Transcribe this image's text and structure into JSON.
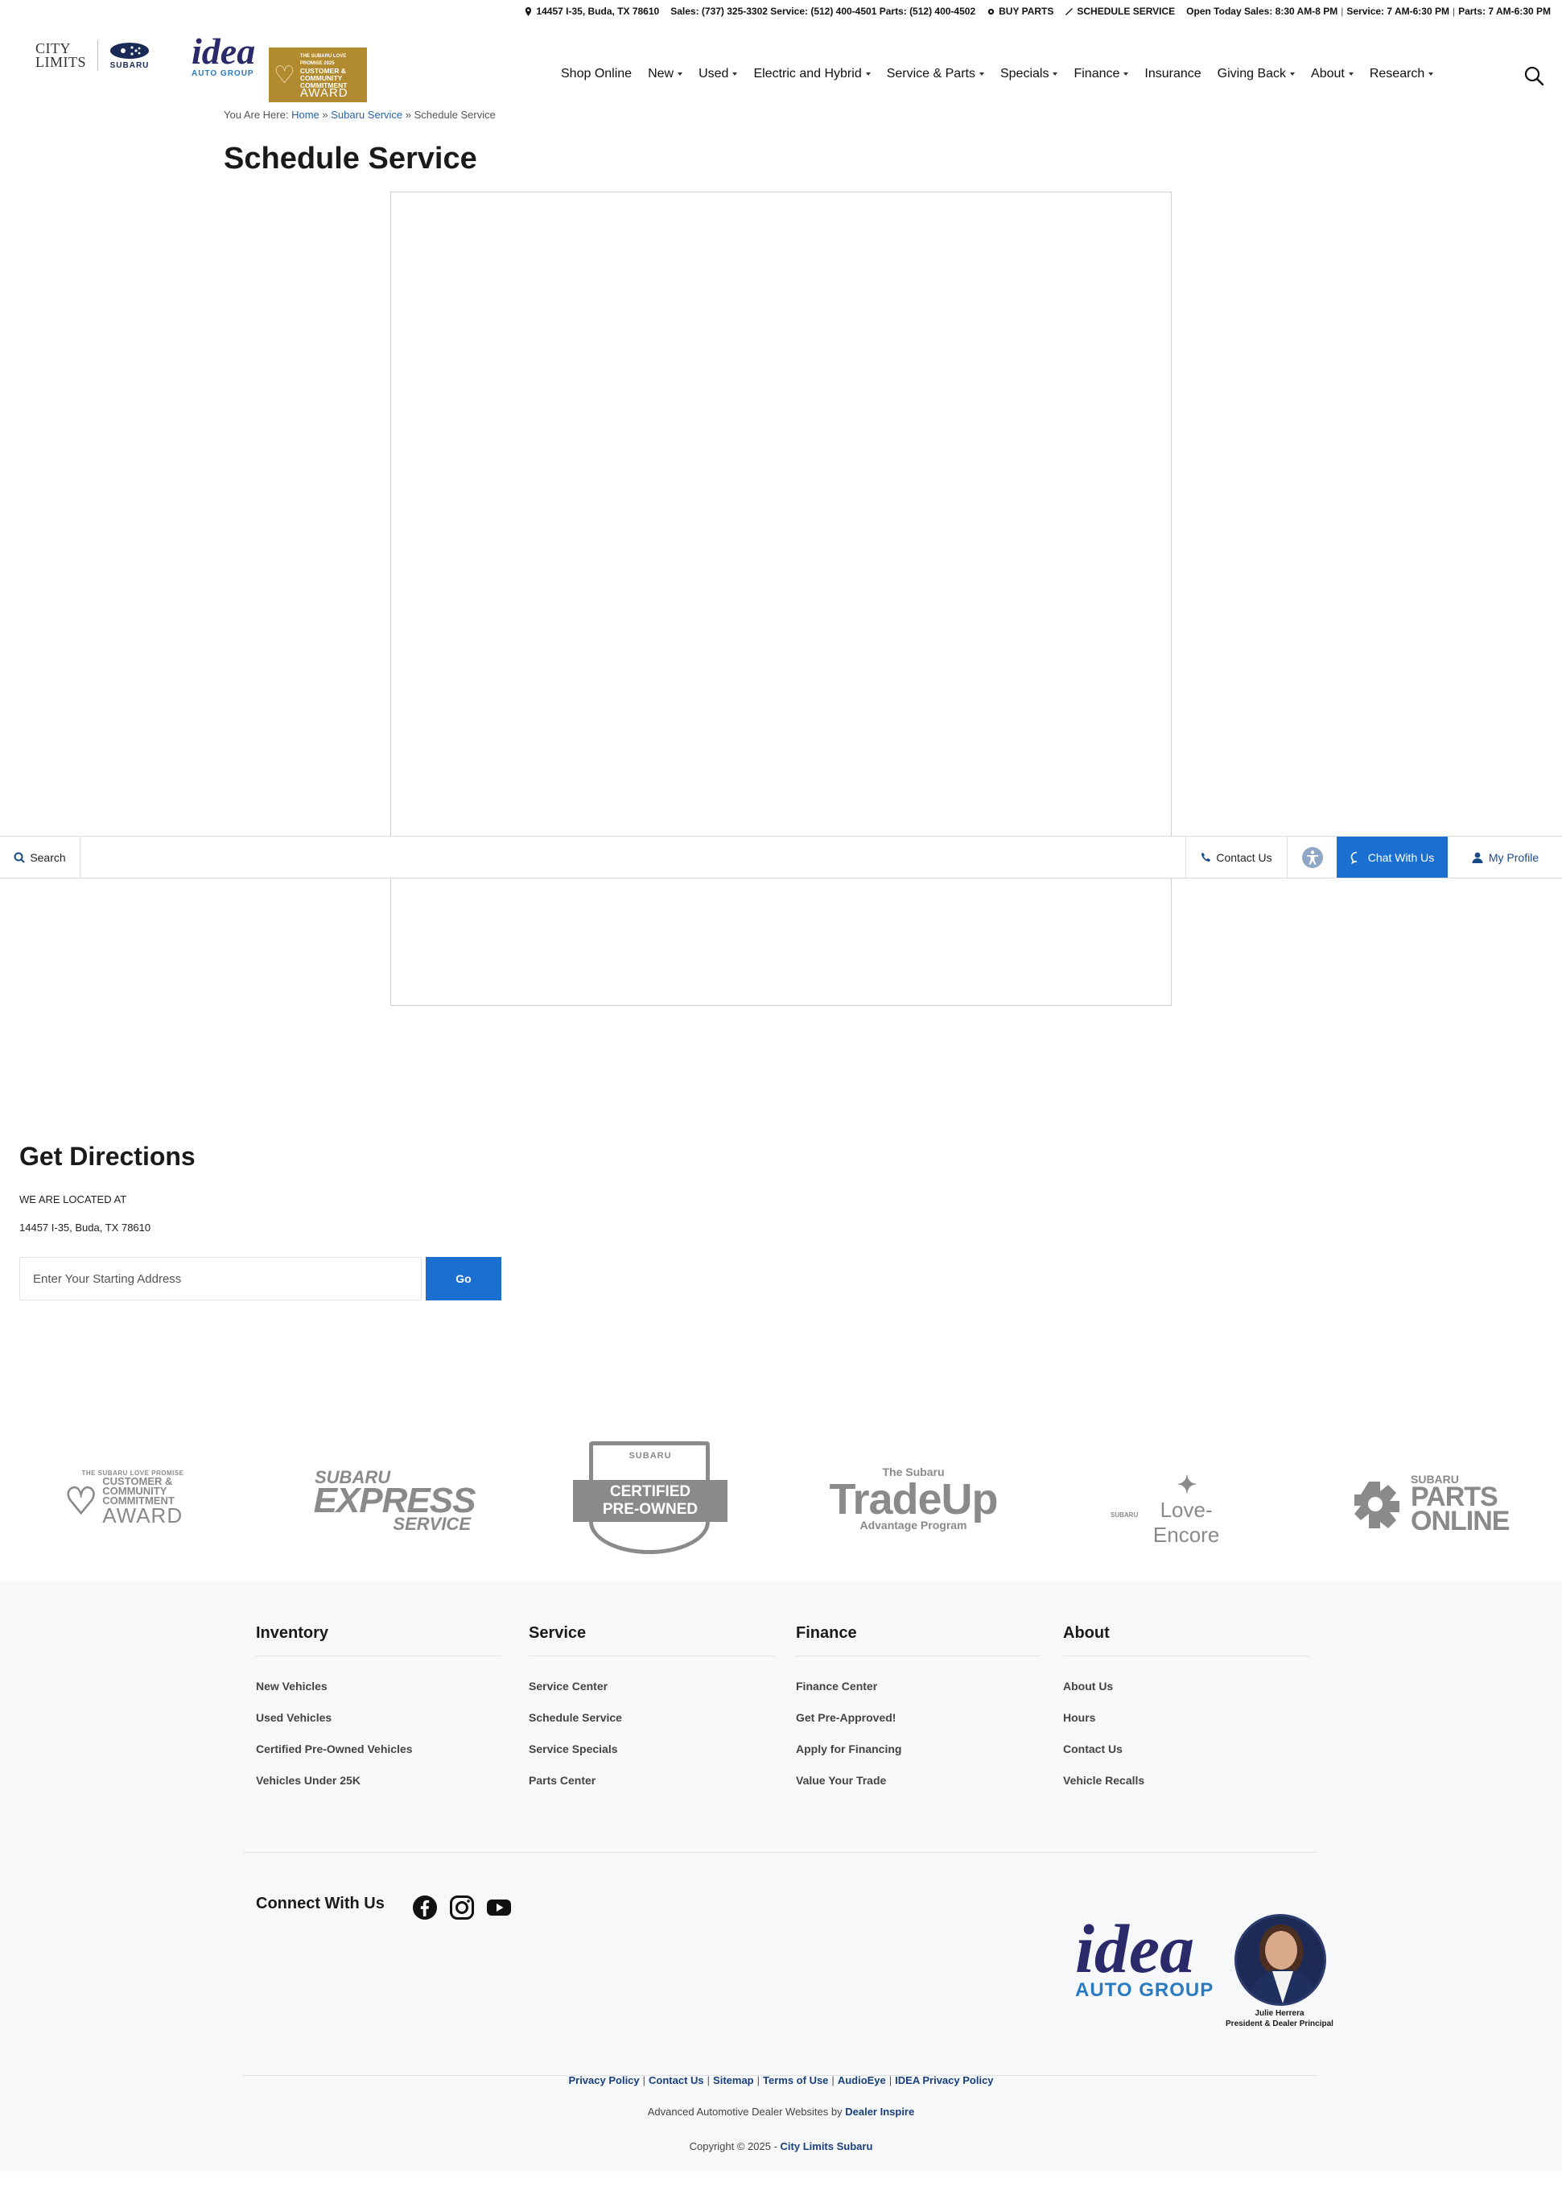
{
  "topbar": {
    "address": "14457 I-35, Buda, TX 78610",
    "phones": "Sales: (737) 325-3302  Service: (512) 400-4501  Parts: (512) 400-4502",
    "buy_parts": "BUY PARTS",
    "schedule_service": "SCHEDULE SERVICE",
    "hours_sales": "Open Today Sales: 8:30 AM-8 PM",
    "hours_service": "Service: 7 AM-6:30 PM",
    "hours_parts": "Parts: 7 AM-6:30 PM",
    "separator": "|"
  },
  "header": {
    "city_logo_line1": "CITY",
    "city_logo_line2": "LIMITS",
    "subaru_logo": "SUBARU",
    "idea_logo": "idea",
    "idea_sub": "AUTO GROUP",
    "award_small": "THE SUBARU LOVE PROMISE 2025",
    "award_lines": "CUSTOMER & COMMUNITY COMMITMENT",
    "award_big": "AWARD"
  },
  "nav": {
    "items": [
      {
        "label": "Shop Online",
        "dropdown": false
      },
      {
        "label": "New",
        "dropdown": true
      },
      {
        "label": "Used",
        "dropdown": true
      },
      {
        "label": "Electric and Hybrid",
        "dropdown": true
      },
      {
        "label": "Service & Parts",
        "dropdown": true
      },
      {
        "label": "Specials",
        "dropdown": true
      },
      {
        "label": "Finance",
        "dropdown": true
      },
      {
        "label": "Insurance",
        "dropdown": false
      },
      {
        "label": "Giving Back",
        "dropdown": true
      },
      {
        "label": "About",
        "dropdown": true
      },
      {
        "label": "Research",
        "dropdown": true
      }
    ]
  },
  "breadcrumb": {
    "prefix": "You Are Here:",
    "home": "Home",
    "sep": "»",
    "parent": "Subaru Service",
    "current": "Schedule Service"
  },
  "page": {
    "title": "Schedule Service"
  },
  "sticky": {
    "search": "Search",
    "contact": "Contact Us",
    "chat": "Chat With Us",
    "profile": "My Profile"
  },
  "directions": {
    "title": "Get Directions",
    "located_label": "WE ARE LOCATED AT",
    "address": "14457 I-35, Buda, TX 78610",
    "input_placeholder": "Enter Your Starting Address",
    "go": "Go"
  },
  "program_logos": {
    "award": {
      "small": "THE SUBARU LOVE PROMISE",
      "lines": "CUSTOMER & COMMUNITY COMMITMENT",
      "big": "AWARD"
    },
    "express": {
      "a": "SUBARU",
      "b": "EXPRESS",
      "c": "SERVICE"
    },
    "cpo": {
      "sub": "SUBARU",
      "line1": "CERTIFIED",
      "line2": "PRE-OWNED"
    },
    "tradeup": {
      "a": "The Subaru",
      "b": "TradeUp",
      "c": "Advantage Program"
    },
    "love_encore": {
      "small": "SUBARU",
      "name": "Love-Encore"
    },
    "parts": {
      "s": "SUBARU",
      "b1": "PARTS",
      "b2": "ONLINE"
    }
  },
  "footer": {
    "columns": [
      {
        "heading": "Inventory",
        "links": [
          "New Vehicles",
          "Used Vehicles",
          "Certified Pre-Owned Vehicles",
          "Vehicles Under 25K"
        ]
      },
      {
        "heading": "Service",
        "links": [
          "Service Center",
          "Schedule Service",
          "Service Specials",
          "Parts Center"
        ]
      },
      {
        "heading": "Finance",
        "links": [
          "Finance Center",
          "Get Pre-Approved!",
          "Apply for Financing",
          "Value Your Trade"
        ]
      },
      {
        "heading": "About",
        "links": [
          "About Us",
          "Hours",
          "Contact Us",
          "Vehicle Recalls"
        ]
      }
    ],
    "connect": "Connect With Us",
    "idea_logo": "idea",
    "idea_sub": "AUTO GROUP",
    "person_name": "Julie Herrera",
    "person_title": "President & Dealer Principal",
    "legal_links": [
      "Privacy Policy",
      "Contact Us",
      "Sitemap",
      "Terms of Use",
      "AudioEye",
      "IDEA Privacy Policy"
    ],
    "credit_text": "Advanced Automotive Dealer Websites by",
    "credit_link": "Dealer Inspire",
    "copyright_text": "Copyright © 2025 -",
    "copyright_link": "City Limits Subaru"
  },
  "colors": {
    "accent": "#1a6fd0",
    "link": "#2563a8",
    "award_gold": "#b28a2f",
    "footer_bg": "#f7f8fa"
  }
}
